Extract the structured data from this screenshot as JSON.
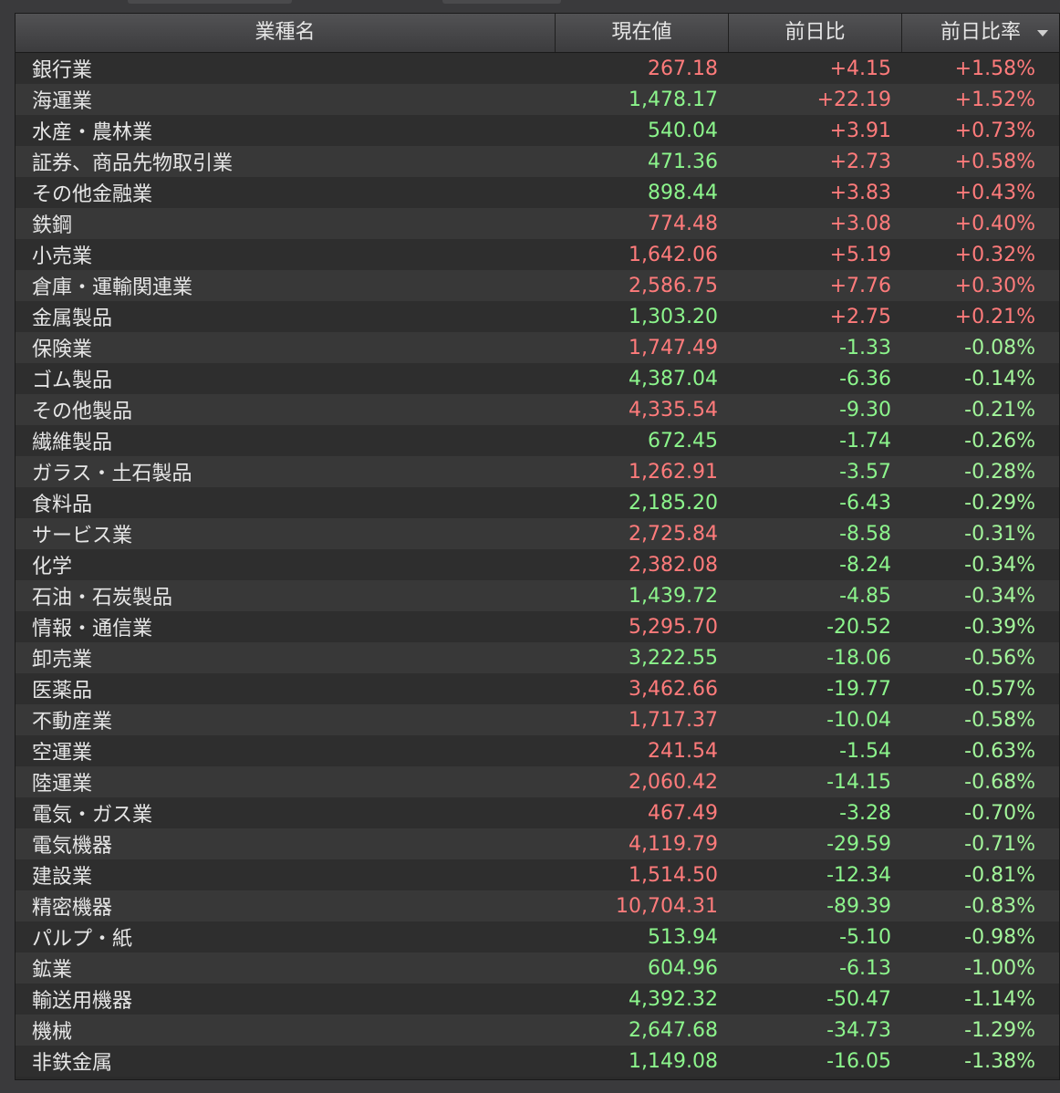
{
  "table": {
    "headers": {
      "name": "業種名",
      "price": "現在値",
      "change": "前日比",
      "change_pct": "前日比率"
    },
    "sort_indicator": "chevron-down-icon",
    "colors": {
      "up": "#ff7b7b",
      "down": "#8cf58c"
    },
    "rows": [
      {
        "name": "銀行業",
        "price": "267.18",
        "price_dir": "up",
        "change": "+4.15",
        "change_pct": "+1.58%"
      },
      {
        "name": "海運業",
        "price": "1,478.17",
        "price_dir": "down",
        "change": "+22.19",
        "change_pct": "+1.52%"
      },
      {
        "name": "水産・農林業",
        "price": "540.04",
        "price_dir": "down",
        "change": "+3.91",
        "change_pct": "+0.73%"
      },
      {
        "name": "証券、商品先物取引業",
        "price": "471.36",
        "price_dir": "down",
        "change": "+2.73",
        "change_pct": "+0.58%"
      },
      {
        "name": "その他金融業",
        "price": "898.44",
        "price_dir": "down",
        "change": "+3.83",
        "change_pct": "+0.43%"
      },
      {
        "name": "鉄鋼",
        "price": "774.48",
        "price_dir": "up",
        "change": "+3.08",
        "change_pct": "+0.40%"
      },
      {
        "name": "小売業",
        "price": "1,642.06",
        "price_dir": "up",
        "change": "+5.19",
        "change_pct": "+0.32%"
      },
      {
        "name": "倉庫・運輸関連業",
        "price": "2,586.75",
        "price_dir": "up",
        "change": "+7.76",
        "change_pct": "+0.30%"
      },
      {
        "name": "金属製品",
        "price": "1,303.20",
        "price_dir": "down",
        "change": "+2.75",
        "change_pct": "+0.21%"
      },
      {
        "name": "保険業",
        "price": "1,747.49",
        "price_dir": "up",
        "change": "-1.33",
        "change_pct": "-0.08%"
      },
      {
        "name": "ゴム製品",
        "price": "4,387.04",
        "price_dir": "down",
        "change": "-6.36",
        "change_pct": "-0.14%"
      },
      {
        "name": "その他製品",
        "price": "4,335.54",
        "price_dir": "up",
        "change": "-9.30",
        "change_pct": "-0.21%"
      },
      {
        "name": "繊維製品",
        "price": "672.45",
        "price_dir": "down",
        "change": "-1.74",
        "change_pct": "-0.26%"
      },
      {
        "name": "ガラス・土石製品",
        "price": "1,262.91",
        "price_dir": "up",
        "change": "-3.57",
        "change_pct": "-0.28%"
      },
      {
        "name": "食料品",
        "price": "2,185.20",
        "price_dir": "down",
        "change": "-6.43",
        "change_pct": "-0.29%"
      },
      {
        "name": "サービス業",
        "price": "2,725.84",
        "price_dir": "up",
        "change": "-8.58",
        "change_pct": "-0.31%"
      },
      {
        "name": "化学",
        "price": "2,382.08",
        "price_dir": "up",
        "change": "-8.24",
        "change_pct": "-0.34%"
      },
      {
        "name": "石油・石炭製品",
        "price": "1,439.72",
        "price_dir": "down",
        "change": "-4.85",
        "change_pct": "-0.34%"
      },
      {
        "name": "情報・通信業",
        "price": "5,295.70",
        "price_dir": "up",
        "change": "-20.52",
        "change_pct": "-0.39%"
      },
      {
        "name": "卸売業",
        "price": "3,222.55",
        "price_dir": "down",
        "change": "-18.06",
        "change_pct": "-0.56%"
      },
      {
        "name": "医薬品",
        "price": "3,462.66",
        "price_dir": "up",
        "change": "-19.77",
        "change_pct": "-0.57%"
      },
      {
        "name": "不動産業",
        "price": "1,717.37",
        "price_dir": "up",
        "change": "-10.04",
        "change_pct": "-0.58%"
      },
      {
        "name": "空運業",
        "price": "241.54",
        "price_dir": "up",
        "change": "-1.54",
        "change_pct": "-0.63%"
      },
      {
        "name": "陸運業",
        "price": "2,060.42",
        "price_dir": "up",
        "change": "-14.15",
        "change_pct": "-0.68%"
      },
      {
        "name": "電気・ガス業",
        "price": "467.49",
        "price_dir": "up",
        "change": "-3.28",
        "change_pct": "-0.70%"
      },
      {
        "name": "電気機器",
        "price": "4,119.79",
        "price_dir": "up",
        "change": "-29.59",
        "change_pct": "-0.71%"
      },
      {
        "name": "建設業",
        "price": "1,514.50",
        "price_dir": "up",
        "change": "-12.34",
        "change_pct": "-0.81%"
      },
      {
        "name": "精密機器",
        "price": "10,704.31",
        "price_dir": "up",
        "change": "-89.39",
        "change_pct": "-0.83%"
      },
      {
        "name": "パルプ・紙",
        "price": "513.94",
        "price_dir": "down",
        "change": "-5.10",
        "change_pct": "-0.98%"
      },
      {
        "name": "鉱業",
        "price": "604.96",
        "price_dir": "down",
        "change": "-6.13",
        "change_pct": "-1.00%"
      },
      {
        "name": "輸送用機器",
        "price": "4,392.32",
        "price_dir": "down",
        "change": "-50.47",
        "change_pct": "-1.14%"
      },
      {
        "name": "機械",
        "price": "2,647.68",
        "price_dir": "down",
        "change": "-34.73",
        "change_pct": "-1.29%"
      },
      {
        "name": "非鉄金属",
        "price": "1,149.08",
        "price_dir": "down",
        "change": "-16.05",
        "change_pct": "-1.38%"
      }
    ]
  }
}
